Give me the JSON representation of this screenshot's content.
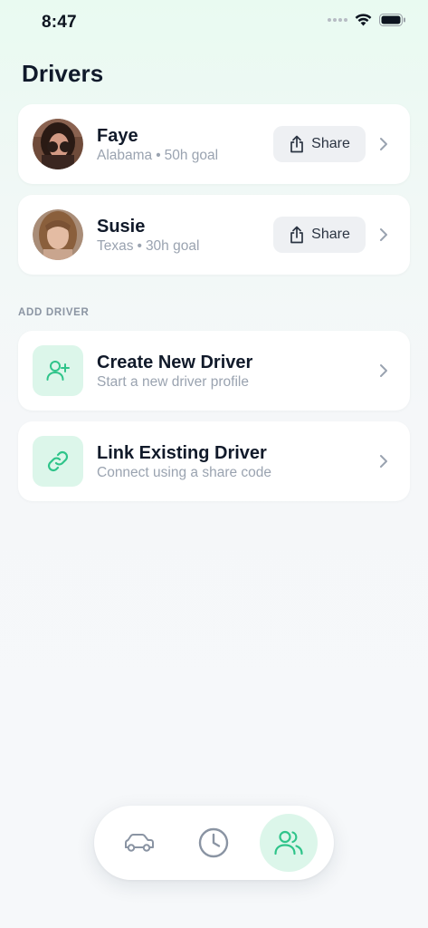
{
  "status_bar": {
    "time": "8:47",
    "icons": [
      "signal-dots-icon",
      "wifi-icon",
      "battery-icon"
    ]
  },
  "title": "Drivers",
  "drivers": [
    {
      "name": "Faye",
      "state": "Alabama",
      "separator": "•",
      "goal": "50h goal",
      "share_label": "Share"
    },
    {
      "name": "Susie",
      "state": "Texas",
      "separator": "•",
      "goal": "30h goal",
      "share_label": "Share"
    }
  ],
  "add_section": {
    "label": "ADD DRIVER",
    "items": [
      {
        "title": "Create New Driver",
        "subtitle": "Start a new driver profile",
        "icon": "user-plus-icon"
      },
      {
        "title": "Link Existing Driver",
        "subtitle": "Connect using a share code",
        "icon": "link-icon"
      }
    ]
  },
  "tab_bar": {
    "tabs": [
      {
        "icon": "car-icon",
        "active": false
      },
      {
        "icon": "clock-icon",
        "active": false
      },
      {
        "icon": "users-icon",
        "active": true
      }
    ]
  },
  "colors": {
    "accent": "#2fc48a",
    "accent_bg": "#dcf6ea",
    "text_primary": "#111a2a",
    "text_secondary": "#9aa3b0"
  }
}
